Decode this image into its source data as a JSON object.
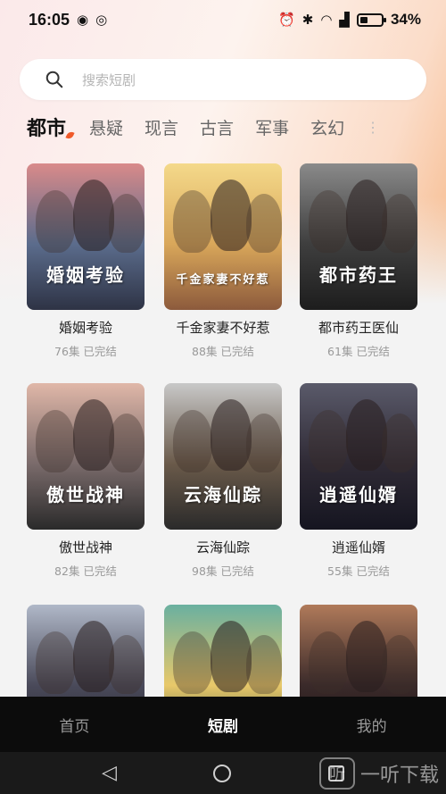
{
  "status": {
    "time": "16:05",
    "battery": "34%"
  },
  "search": {
    "placeholder": "搜索短剧"
  },
  "tabs": [
    "都市",
    "悬疑",
    "现言",
    "古言",
    "军事",
    "玄幻"
  ],
  "dramas": [
    {
      "title": "婚姻考验",
      "meta": "76集  已完结",
      "poster_text": "婚姻考验",
      "colors": [
        "#d98a8a",
        "#5b6c8c",
        "#2e3345"
      ]
    },
    {
      "title": "千金家妻不好惹",
      "meta": "88集  已完结",
      "poster_text": "千金家妻不好惹",
      "colors": [
        "#f4d98a",
        "#d9a75a",
        "#8c5a3c"
      ]
    },
    {
      "title": "都市药王医仙",
      "meta": "61集  已完结",
      "poster_text": "都市药王",
      "colors": [
        "#8a8a8a",
        "#3e3e3e",
        "#1d1d1d"
      ]
    },
    {
      "title": "傲世战神",
      "meta": "82集  已完结",
      "poster_text": "傲世战神",
      "colors": [
        "#e0b7a8",
        "#7a6b6b",
        "#2a2a2a"
      ]
    },
    {
      "title": "云海仙踪",
      "meta": "98集  已完结",
      "poster_text": "云海仙踪",
      "colors": [
        "#c8c8c8",
        "#6a5a4a",
        "#2a2a2a"
      ]
    },
    {
      "title": "逍遥仙婿",
      "meta": "55集  已完结",
      "poster_text": "逍遥仙婿",
      "colors": [
        "#5a5a6a",
        "#2f2a35",
        "#151520"
      ]
    },
    {
      "title": "",
      "meta": "",
      "poster_text": "",
      "colors": [
        "#b0b8c8",
        "#4a4a5a",
        "#202028"
      ]
    },
    {
      "title": "",
      "meta": "",
      "poster_text": "",
      "colors": [
        "#6ab0a0",
        "#e8c86a",
        "#2a4a40"
      ]
    },
    {
      "title": "",
      "meta": "",
      "poster_text": "",
      "colors": [
        "#b07a5a",
        "#3a2a2a",
        "#1a1010"
      ]
    }
  ],
  "bottom_nav": [
    "首页",
    "短剧",
    "我的"
  ],
  "watermark": "一听下载"
}
